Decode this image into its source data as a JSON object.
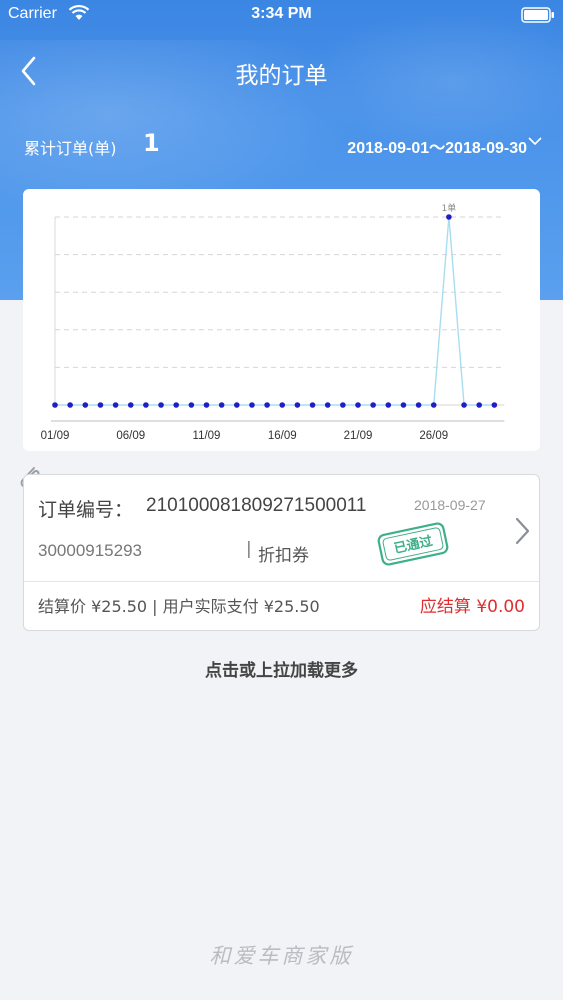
{
  "status_bar": {
    "carrier": "Carrier",
    "time": "3:34 PM"
  },
  "nav": {
    "title": "我的订单"
  },
  "summary": {
    "label": "累计订单(单)",
    "count": "1",
    "date_range": "2018-09-01～2018-09-30"
  },
  "chart_data": {
    "type": "line",
    "x_tick_labels": [
      "01/09",
      "06/09",
      "11/09",
      "16/09",
      "21/09",
      "26/09"
    ],
    "x": [
      "09-01",
      "09-02",
      "09-03",
      "09-04",
      "09-05",
      "09-06",
      "09-07",
      "09-08",
      "09-09",
      "09-10",
      "09-11",
      "09-12",
      "09-13",
      "09-14",
      "09-15",
      "09-16",
      "09-17",
      "09-18",
      "09-19",
      "09-20",
      "09-21",
      "09-22",
      "09-23",
      "09-24",
      "09-25",
      "09-26",
      "09-27",
      "09-28",
      "09-29",
      "09-30"
    ],
    "series": [
      {
        "values": [
          0,
          0,
          0,
          0,
          0,
          0,
          0,
          0,
          0,
          0,
          0,
          0,
          0,
          0,
          0,
          0,
          0,
          0,
          0,
          0,
          0,
          0,
          0,
          0,
          0,
          0,
          1,
          0,
          0,
          0
        ]
      }
    ],
    "annotations": [
      {
        "x": "09-27",
        "text": "1单"
      }
    ],
    "ylim": [
      0,
      1
    ],
    "grid": true,
    "colors": {
      "line": "#a8ddf0",
      "point": "#1f1fc8",
      "grid": "#d6d6d6"
    }
  },
  "order": {
    "number_label": "订单编号：",
    "number": "210100081809271500011",
    "date": "2018-09-27",
    "phone": "30000915293",
    "separator": "|",
    "type": "折扣券",
    "stamp_text": "已通过",
    "settle_info": "结算价 ¥25.50  |  用户实际支付 ¥25.50",
    "due": "应结算 ¥0.00"
  },
  "load_more": "点击或上拉加载更多",
  "footer": "和爱车商家版",
  "colors": {
    "header_blue": "#3b86e3",
    "due_red": "#e02e2e",
    "stamp_green": "#3fae8a"
  }
}
